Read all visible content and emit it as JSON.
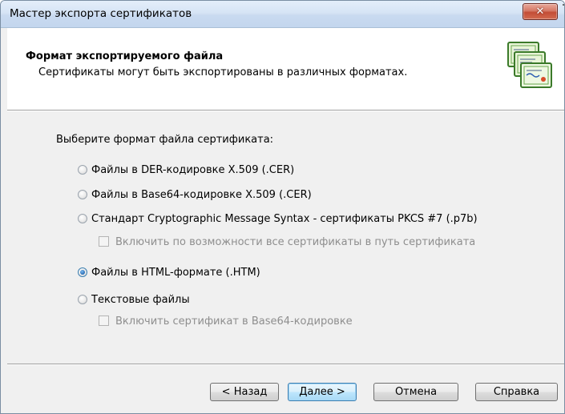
{
  "window": {
    "title": "Мастер экспорта сертификатов",
    "close_glyph": "✕"
  },
  "header": {
    "title": "Формат экспортируемого файла",
    "subtitle": "Сертификаты могут быть экспортированы в различных форматах.",
    "icon": "certificates-icon"
  },
  "content": {
    "prompt": "Выберите формат файла сертификата:",
    "options": [
      {
        "label": "Файлы в DER-кодировке X.509 (.CER)",
        "checked": false
      },
      {
        "label": "Файлы в Base64-кодировке X.509 (.CER)",
        "checked": false
      },
      {
        "label": "Стандарт Cryptographic Message Syntax - сертификаты PKCS #7 (.p7b)",
        "checked": false
      },
      {
        "label": "Файлы в HTML-формате (.HTM)",
        "checked": true
      },
      {
        "label": "Текстовые файлы",
        "checked": false
      }
    ],
    "checkboxes": [
      {
        "label": "Включить по возможности все сертификаты в путь сертификата",
        "checked": false,
        "enabled": false
      },
      {
        "label": "Включить сертификат в Base64-кодировке",
        "checked": false,
        "enabled": false
      }
    ]
  },
  "buttons": {
    "back": "< Назад",
    "next": "Далее >",
    "cancel": "Отмена",
    "help": "Справка"
  },
  "colors": {
    "title_bar": "#c9daf0",
    "dialog_bg": "#f0f0f0",
    "header_bg": "#ffffff",
    "close_button": "#c34d36",
    "default_button": "#bee6fd",
    "disabled_text": "#8e8e8e"
  }
}
